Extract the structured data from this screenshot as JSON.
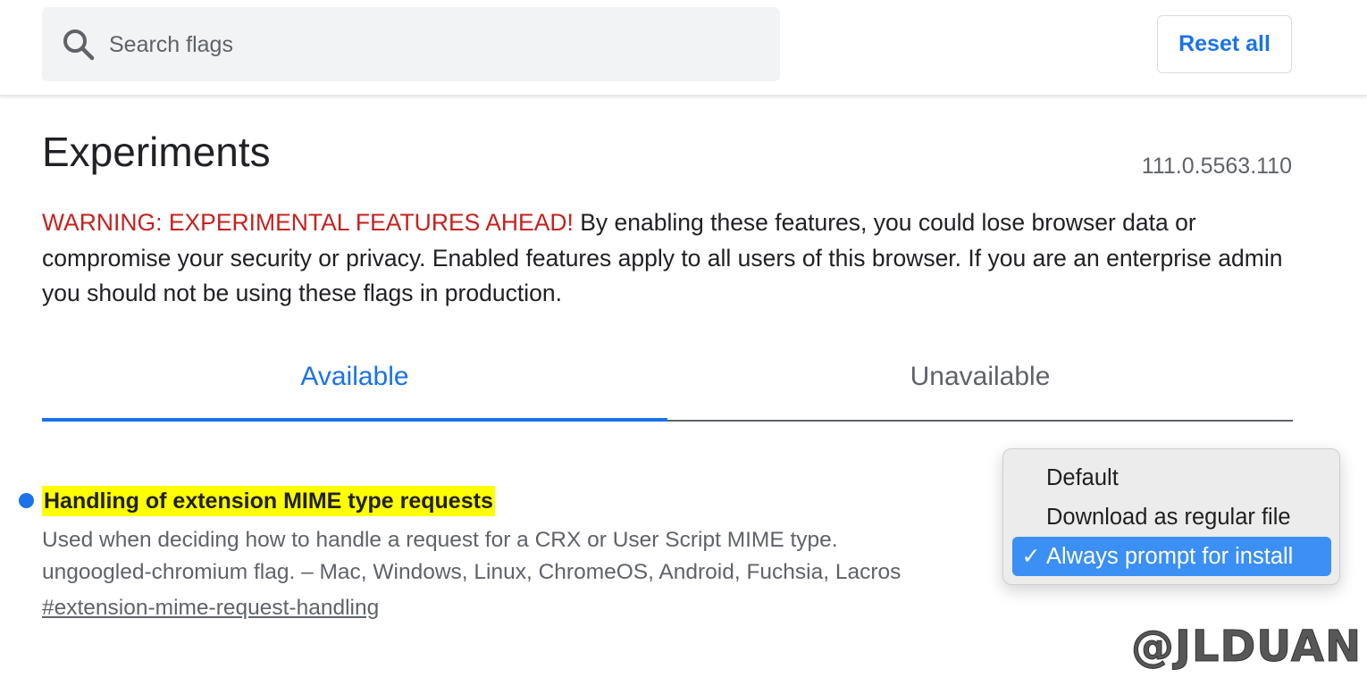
{
  "header": {
    "search": {
      "placeholder": "Search flags",
      "value": "",
      "icon": "search-icon"
    },
    "reset_label": "Reset all"
  },
  "page": {
    "title": "Experiments",
    "version": "111.0.5563.110",
    "warning_label": "WARNING: EXPERIMENTAL FEATURES AHEAD!",
    "warning_text": " By enabling these features, you could lose browser data or compromise your security or privacy. Enabled features apply to all users of this browser. If you are an enterprise admin you should not be using these flags in production."
  },
  "tabs": [
    {
      "label": "Available",
      "active": true
    },
    {
      "label": "Unavailable",
      "active": false
    }
  ],
  "flag": {
    "title": "Handling of extension MIME type requests",
    "description": "Used when deciding how to handle a request for a CRX or User Script MIME type.",
    "platforms": "ungoogled-chromium flag. – Mac, Windows, Linux, ChromeOS, Android, Fuchsia, Lacros",
    "link": "#extension-mime-request-handling"
  },
  "dropdown": {
    "options": [
      {
        "label": "Default",
        "selected": false
      },
      {
        "label": "Download as regular file",
        "selected": false
      },
      {
        "label": "Always prompt for install",
        "selected": true
      }
    ],
    "check_glyph": "✓"
  },
  "watermark": "@JLDUAN",
  "colors": {
    "accent": "#1a73e8",
    "warning": "#c5221f",
    "highlight": "#ffff00",
    "menu_selected": "#3b8ff5"
  }
}
